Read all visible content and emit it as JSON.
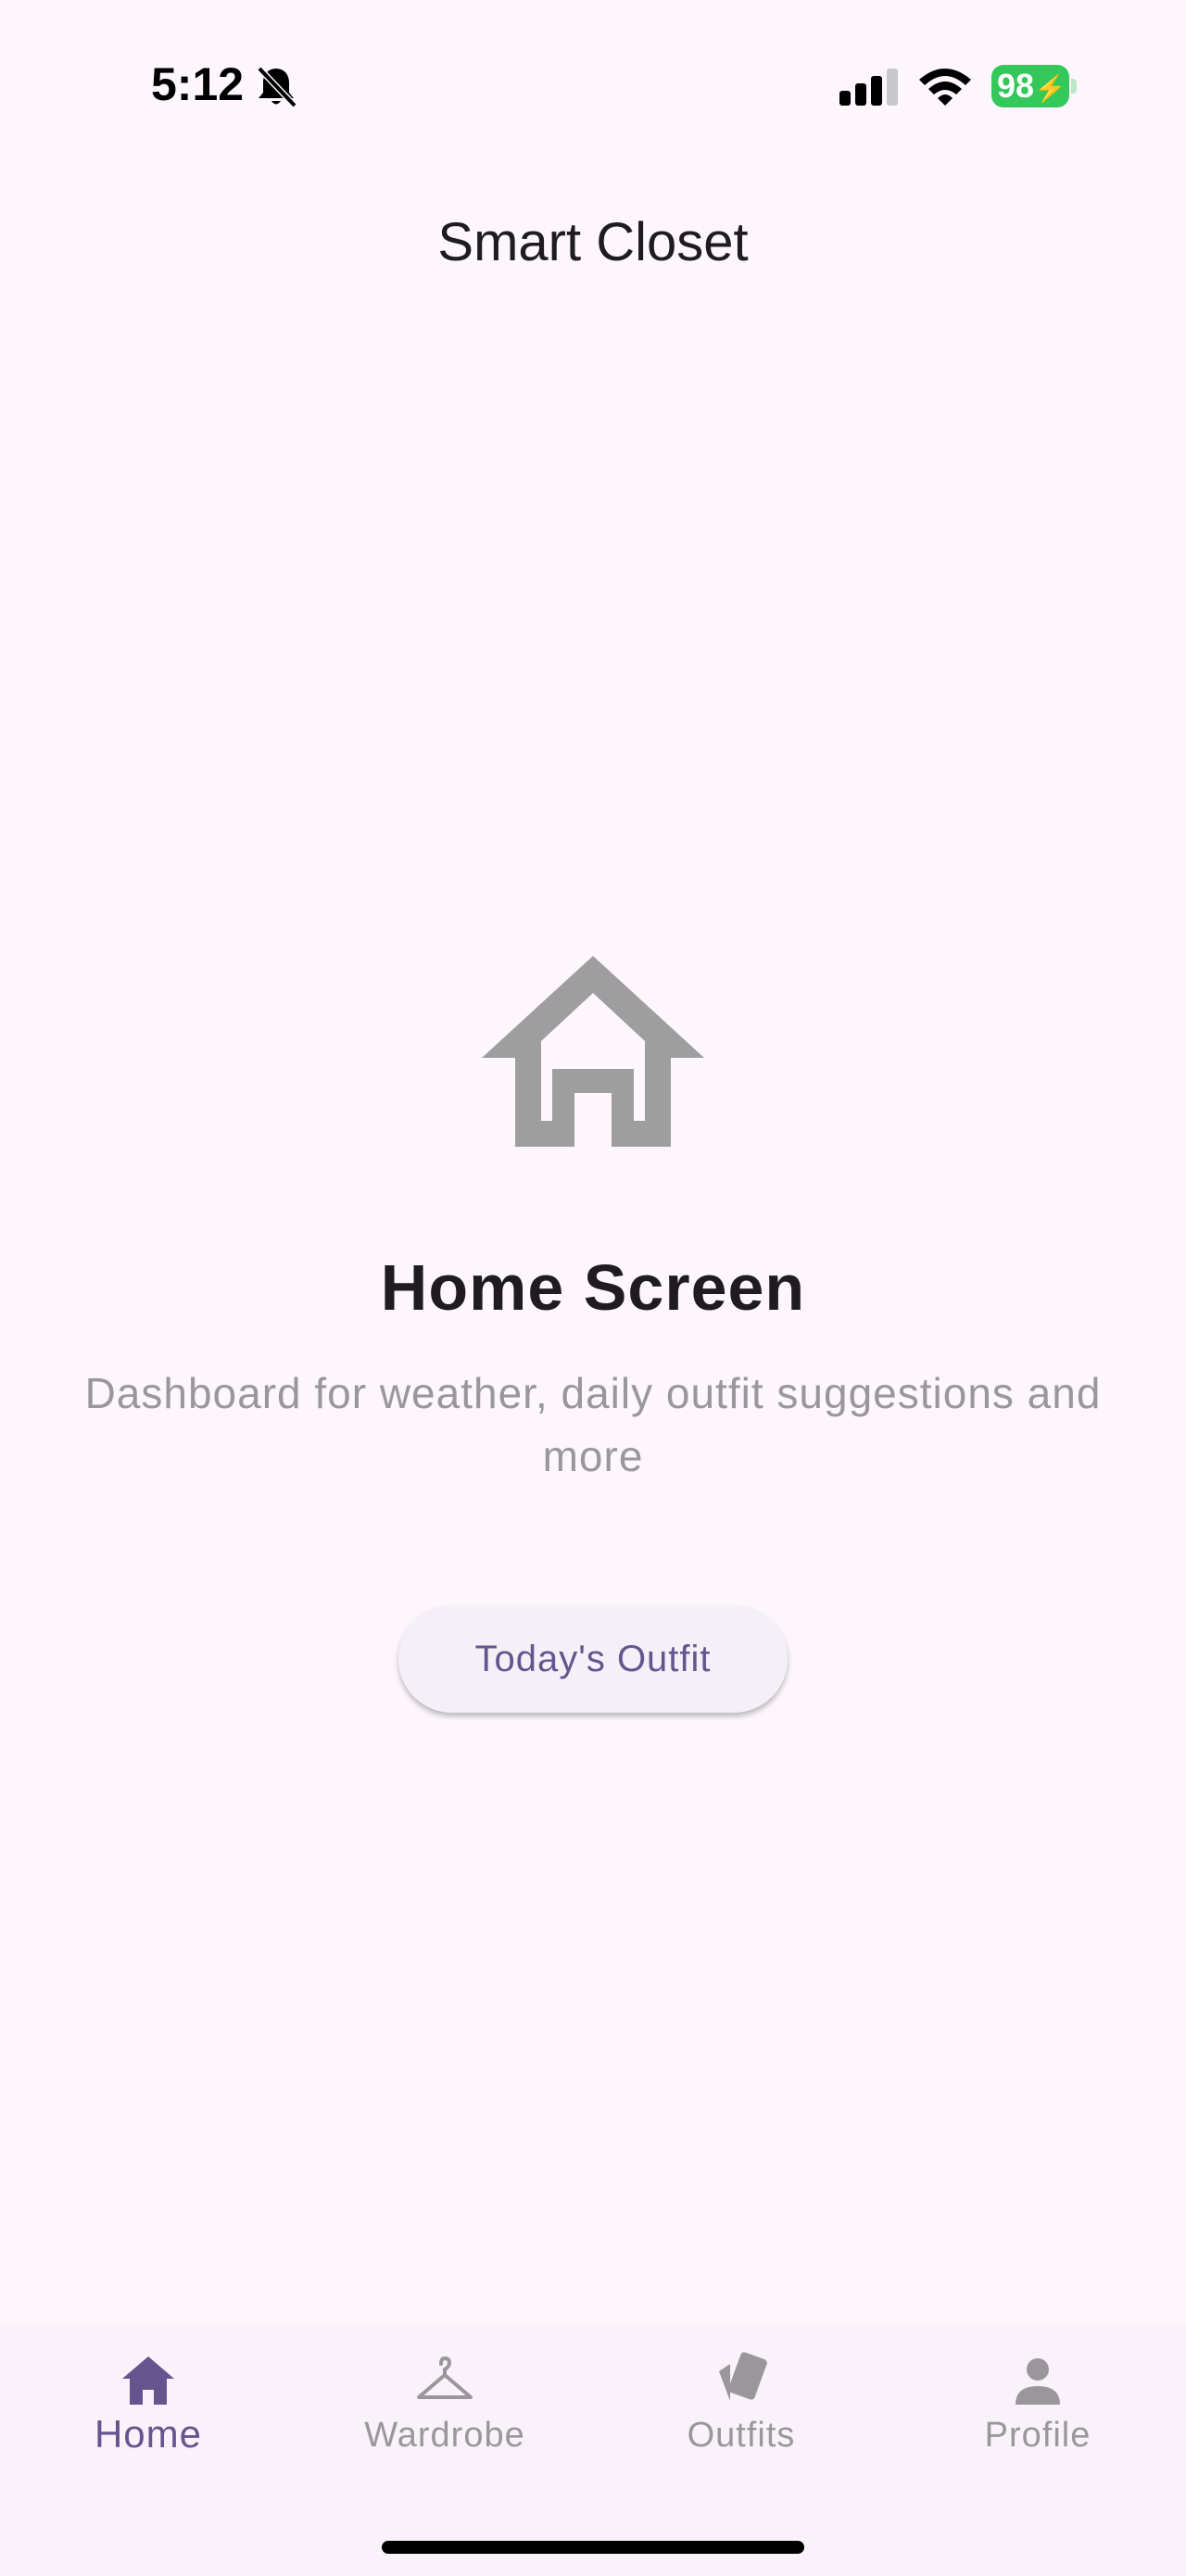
{
  "status_bar": {
    "time": "5:12",
    "battery_level": "98",
    "icons": [
      "bell-slash-icon",
      "signal-icon",
      "wifi-icon",
      "battery-charging-icon"
    ]
  },
  "app_bar": {
    "title": "Smart Closet"
  },
  "main": {
    "icon": "home-outline-icon",
    "title": "Home Screen",
    "subtitle": "Dashboard for weather, daily outfit suggestions and more",
    "button_label": "Today's Outfit"
  },
  "bottom_nav": {
    "items": [
      {
        "label": "Home",
        "icon": "home-icon",
        "active": true
      },
      {
        "label": "Wardrobe",
        "icon": "hanger-icon",
        "active": false
      },
      {
        "label": "Outfits",
        "icon": "cards-icon",
        "active": false
      },
      {
        "label": "Profile",
        "icon": "person-icon",
        "active": false
      }
    ]
  },
  "colors": {
    "background": "#fdf7fd",
    "accent": "#65558f",
    "muted": "#9a979b",
    "battery": "#34c759"
  }
}
